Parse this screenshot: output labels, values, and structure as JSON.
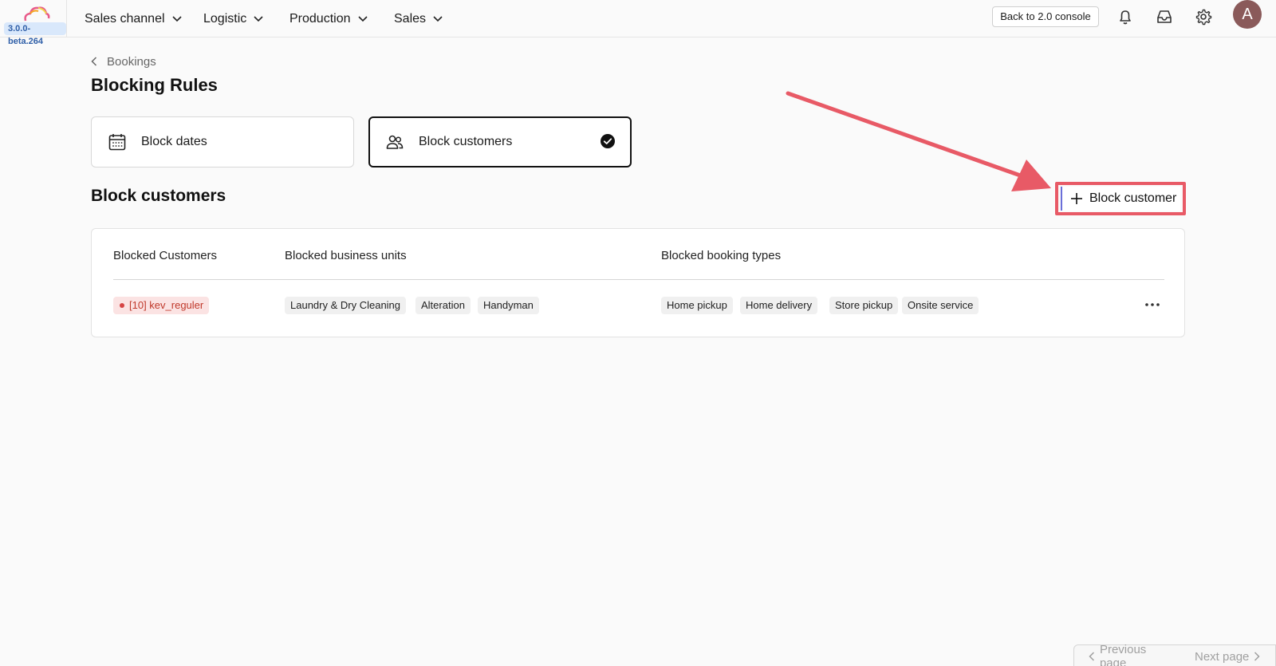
{
  "header": {
    "version": "3.0.0-beta.264",
    "nav": [
      "Sales channel",
      "Logistic",
      "Production",
      "Sales"
    ],
    "console_button": "Back to 2.0 console",
    "avatar_initial": "A",
    "icons": [
      "bell-icon",
      "inbox-icon",
      "gear-icon"
    ]
  },
  "breadcrumb": {
    "label": "Bookings"
  },
  "page": {
    "title": "Blocking Rules"
  },
  "cards": [
    {
      "label": "Block dates",
      "icon": "calendar-icon",
      "selected": false
    },
    {
      "label": "Block customers",
      "icon": "users-icon",
      "selected": true
    }
  ],
  "section": {
    "title": "Block customers",
    "add_button": "Block customer"
  },
  "table": {
    "headers": [
      "Blocked Customers",
      "Blocked business units",
      "Blocked booking types"
    ],
    "rows": [
      {
        "customer": "[10] kev_reguler",
        "business_units": [
          "Laundry & Dry Cleaning",
          "Alteration",
          "Handyman"
        ],
        "booking_types": [
          "Home pickup",
          "Home delivery",
          "Store pickup",
          "Onsite service"
        ]
      }
    ]
  },
  "pagination": {
    "previous": "Previous page",
    "next": "Next page"
  },
  "colors": {
    "highlight": "#e85a66",
    "accent": "#6b6fd9"
  }
}
